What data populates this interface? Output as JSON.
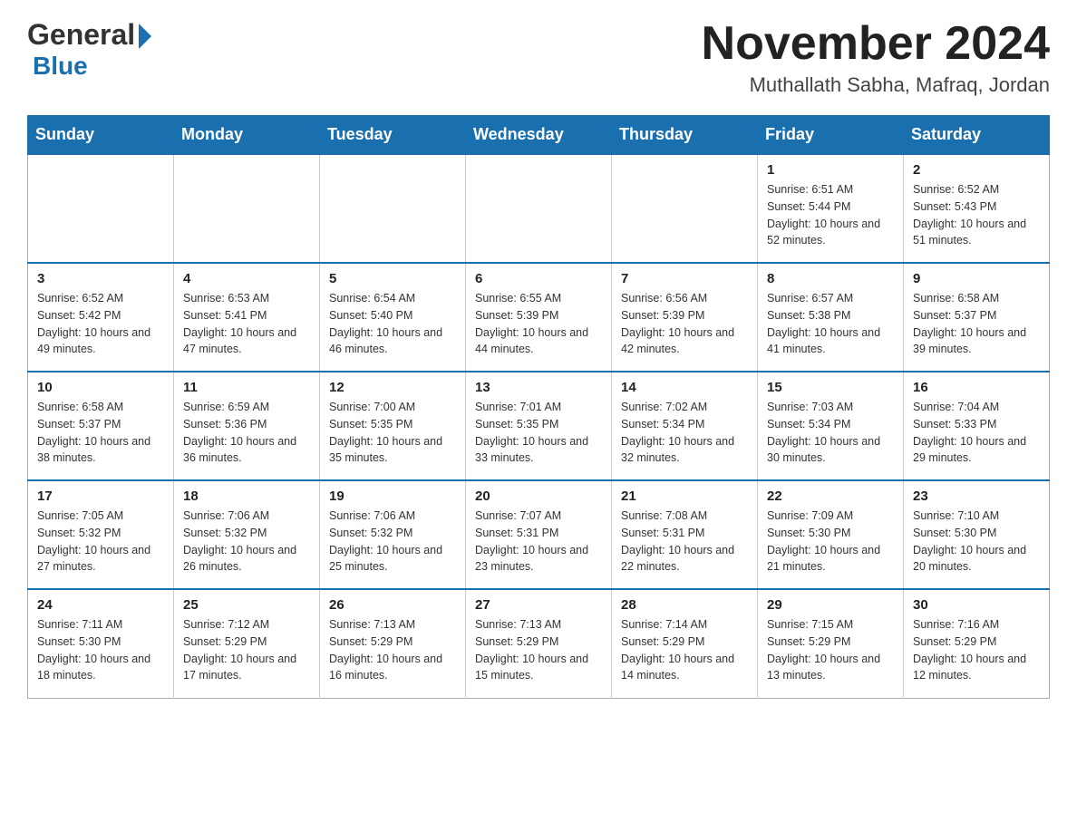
{
  "header": {
    "logo_general": "General",
    "logo_blue": "Blue",
    "main_title": "November 2024",
    "subtitle": "Muthallath Sabha, Mafraq, Jordan"
  },
  "calendar": {
    "days_of_week": [
      "Sunday",
      "Monday",
      "Tuesday",
      "Wednesday",
      "Thursday",
      "Friday",
      "Saturday"
    ],
    "weeks": [
      [
        {
          "day": "",
          "info": ""
        },
        {
          "day": "",
          "info": ""
        },
        {
          "day": "",
          "info": ""
        },
        {
          "day": "",
          "info": ""
        },
        {
          "day": "",
          "info": ""
        },
        {
          "day": "1",
          "info": "Sunrise: 6:51 AM\nSunset: 5:44 PM\nDaylight: 10 hours and 52 minutes."
        },
        {
          "day": "2",
          "info": "Sunrise: 6:52 AM\nSunset: 5:43 PM\nDaylight: 10 hours and 51 minutes."
        }
      ],
      [
        {
          "day": "3",
          "info": "Sunrise: 6:52 AM\nSunset: 5:42 PM\nDaylight: 10 hours and 49 minutes."
        },
        {
          "day": "4",
          "info": "Sunrise: 6:53 AM\nSunset: 5:41 PM\nDaylight: 10 hours and 47 minutes."
        },
        {
          "day": "5",
          "info": "Sunrise: 6:54 AM\nSunset: 5:40 PM\nDaylight: 10 hours and 46 minutes."
        },
        {
          "day": "6",
          "info": "Sunrise: 6:55 AM\nSunset: 5:39 PM\nDaylight: 10 hours and 44 minutes."
        },
        {
          "day": "7",
          "info": "Sunrise: 6:56 AM\nSunset: 5:39 PM\nDaylight: 10 hours and 42 minutes."
        },
        {
          "day": "8",
          "info": "Sunrise: 6:57 AM\nSunset: 5:38 PM\nDaylight: 10 hours and 41 minutes."
        },
        {
          "day": "9",
          "info": "Sunrise: 6:58 AM\nSunset: 5:37 PM\nDaylight: 10 hours and 39 minutes."
        }
      ],
      [
        {
          "day": "10",
          "info": "Sunrise: 6:58 AM\nSunset: 5:37 PM\nDaylight: 10 hours and 38 minutes."
        },
        {
          "day": "11",
          "info": "Sunrise: 6:59 AM\nSunset: 5:36 PM\nDaylight: 10 hours and 36 minutes."
        },
        {
          "day": "12",
          "info": "Sunrise: 7:00 AM\nSunset: 5:35 PM\nDaylight: 10 hours and 35 minutes."
        },
        {
          "day": "13",
          "info": "Sunrise: 7:01 AM\nSunset: 5:35 PM\nDaylight: 10 hours and 33 minutes."
        },
        {
          "day": "14",
          "info": "Sunrise: 7:02 AM\nSunset: 5:34 PM\nDaylight: 10 hours and 32 minutes."
        },
        {
          "day": "15",
          "info": "Sunrise: 7:03 AM\nSunset: 5:34 PM\nDaylight: 10 hours and 30 minutes."
        },
        {
          "day": "16",
          "info": "Sunrise: 7:04 AM\nSunset: 5:33 PM\nDaylight: 10 hours and 29 minutes."
        }
      ],
      [
        {
          "day": "17",
          "info": "Sunrise: 7:05 AM\nSunset: 5:32 PM\nDaylight: 10 hours and 27 minutes."
        },
        {
          "day": "18",
          "info": "Sunrise: 7:06 AM\nSunset: 5:32 PM\nDaylight: 10 hours and 26 minutes."
        },
        {
          "day": "19",
          "info": "Sunrise: 7:06 AM\nSunset: 5:32 PM\nDaylight: 10 hours and 25 minutes."
        },
        {
          "day": "20",
          "info": "Sunrise: 7:07 AM\nSunset: 5:31 PM\nDaylight: 10 hours and 23 minutes."
        },
        {
          "day": "21",
          "info": "Sunrise: 7:08 AM\nSunset: 5:31 PM\nDaylight: 10 hours and 22 minutes."
        },
        {
          "day": "22",
          "info": "Sunrise: 7:09 AM\nSunset: 5:30 PM\nDaylight: 10 hours and 21 minutes."
        },
        {
          "day": "23",
          "info": "Sunrise: 7:10 AM\nSunset: 5:30 PM\nDaylight: 10 hours and 20 minutes."
        }
      ],
      [
        {
          "day": "24",
          "info": "Sunrise: 7:11 AM\nSunset: 5:30 PM\nDaylight: 10 hours and 18 minutes."
        },
        {
          "day": "25",
          "info": "Sunrise: 7:12 AM\nSunset: 5:29 PM\nDaylight: 10 hours and 17 minutes."
        },
        {
          "day": "26",
          "info": "Sunrise: 7:13 AM\nSunset: 5:29 PM\nDaylight: 10 hours and 16 minutes."
        },
        {
          "day": "27",
          "info": "Sunrise: 7:13 AM\nSunset: 5:29 PM\nDaylight: 10 hours and 15 minutes."
        },
        {
          "day": "28",
          "info": "Sunrise: 7:14 AM\nSunset: 5:29 PM\nDaylight: 10 hours and 14 minutes."
        },
        {
          "day": "29",
          "info": "Sunrise: 7:15 AM\nSunset: 5:29 PM\nDaylight: 10 hours and 13 minutes."
        },
        {
          "day": "30",
          "info": "Sunrise: 7:16 AM\nSunset: 5:29 PM\nDaylight: 10 hours and 12 minutes."
        }
      ]
    ]
  }
}
